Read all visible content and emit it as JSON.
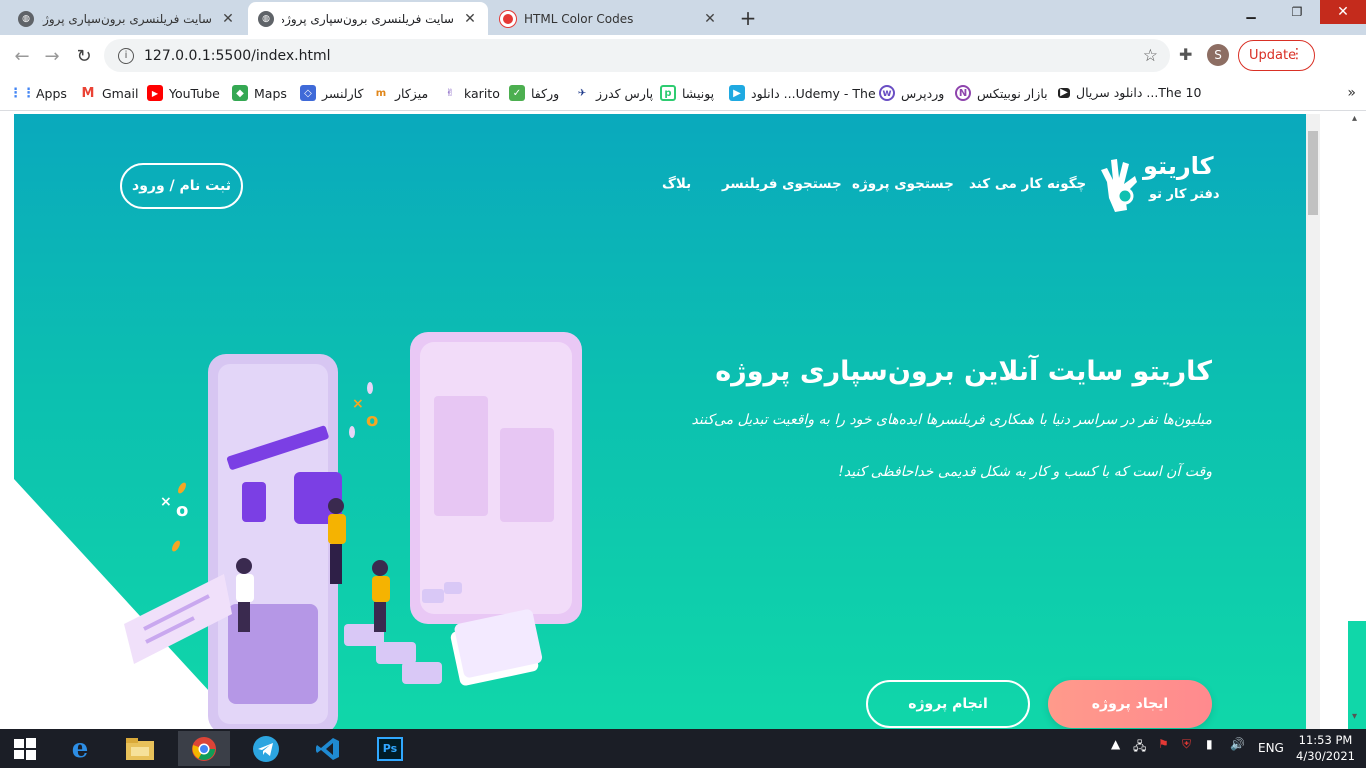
{
  "browser": {
    "tabs": [
      {
        "label": "سایت فریلنسری برون‌سپاری پروژه به",
        "close": "✕"
      },
      {
        "label": "سایت فریلنسری برون‌سپاری پروژه به",
        "close": "✕"
      },
      {
        "label": "HTML Color Codes",
        "close": "✕"
      }
    ],
    "new_tab": "+",
    "url": "127.0.0.1:5500/index.html",
    "profile_initial": "S",
    "update_label": "Update",
    "bookmarks": [
      {
        "label": "Apps",
        "icon": "apps-grid-icon"
      },
      {
        "label": "Gmail",
        "icon": "gmail-icon"
      },
      {
        "label": "YouTube",
        "icon": "youtube-icon"
      },
      {
        "label": "Maps",
        "icon": "maps-icon"
      },
      {
        "label": "کارلنسر",
        "icon": "karlancer-icon"
      },
      {
        "label": "میزکار",
        "icon": "mizkar-icon"
      },
      {
        "label": "karito",
        "icon": "karito-icon"
      },
      {
        "label": "ورکفا",
        "icon": "workfa-icon"
      },
      {
        "label": "پارس کدرز",
        "icon": "parscoders-icon"
      },
      {
        "label": "پونیشا",
        "icon": "ponisha-icon"
      },
      {
        "label": "دانلود ...Udemy - The",
        "icon": "udemy-download-icon"
      },
      {
        "label": "وردپرس",
        "icon": "wordpress-icon"
      },
      {
        "label": "بازار نوبیتکس",
        "icon": "nobitex-icon"
      },
      {
        "label": "دانلود سریال ...The 10",
        "icon": "video-icon"
      }
    ]
  },
  "site": {
    "brand_name": "کاریتو",
    "brand_tagline": "دفتر کار تو",
    "nav": [
      "چگونه کار می کند",
      "جستجوی پروژه",
      "جستجوی فریلنسر",
      "بلاگ"
    ],
    "login_button": "ثبت نام / ورود",
    "hero_title": "کاریتو سایت آنلاین برون‌سپاری پروژه",
    "hero_line1": "میلیون‌ها نفر در سراسر دنیا با همکاری فریلنسرها ایده‌های خود را به واقعیت تبدیل می‌کنند",
    "hero_line2": "وقت آن است که با کسب و کار به شکل قدیمی خداحافظی کنید!",
    "create_project": "ایجاد پروژه",
    "do_project": "انجام پروژه"
  },
  "taskbar": {
    "language": "ENG",
    "time": "11:53 PM",
    "date": "4/30/2021"
  },
  "colors": {
    "hero_top": "#0aa9bd",
    "hero_bottom": "#10d7a9",
    "create_button": "#ff9a8b",
    "update_red": "#d93025"
  }
}
